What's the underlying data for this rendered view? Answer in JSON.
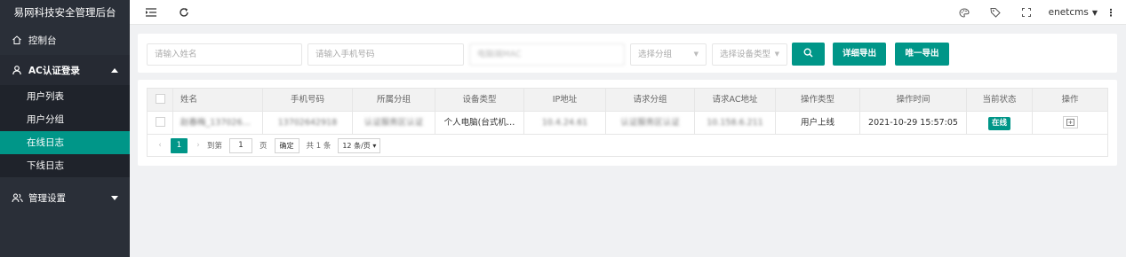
{
  "brand": "易网科技安全管理后台",
  "colors": {
    "accent": "#009688",
    "sidebar_bg": "#2a2f38",
    "submenu_bg": "#1f232b"
  },
  "sidebar": {
    "dashboard": {
      "label": "控制台",
      "icon": "home-icon"
    },
    "ac_login": {
      "label": "AC认证登录",
      "icon": "user-icon",
      "expanded": true
    },
    "sub_items": [
      {
        "label": "用户列表"
      },
      {
        "label": "用户分组"
      },
      {
        "label": "在线日志",
        "active": true
      },
      {
        "label": "下线日志"
      }
    ],
    "settings": {
      "label": "管理设置",
      "icon": "users-icon"
    }
  },
  "header": {
    "user": "enetcms",
    "icons": [
      "menu-collapse-icon",
      "refresh-icon",
      "theme-icon",
      "tag-icon",
      "fullscreen-icon",
      "more-icon"
    ]
  },
  "filters": {
    "name_placeholder": "请输入姓名",
    "phone_placeholder": "请输入手机号码",
    "third_input_value": "电脑端MAC",
    "group_placeholder": "选择分组",
    "device_placeholder": "选择设备类型",
    "detail_export": "详细导出",
    "unique_export": "唯一导出"
  },
  "table": {
    "headers": [
      "姓名",
      "手机号码",
      "所属分组",
      "设备类型",
      "IP地址",
      "请求分组",
      "请求AC地址",
      "操作类型",
      "操作时间",
      "当前状态",
      "操作"
    ],
    "rows": [
      {
        "name": "赵春梅_137026…",
        "phone": "13702642918",
        "group": "认证服务区认证",
        "device": "个人电脑(台式机…",
        "ip": "10.4.24.61",
        "req_group": "认证服务区认证",
        "ac_addr": "10.158.6.211",
        "op_type": "用户上线",
        "op_time": "2021-10-29 15:57:05",
        "status": "在线"
      }
    ]
  },
  "pager": {
    "current": "1",
    "goto_label": "到第",
    "page_input": "1",
    "page_unit": "页",
    "confirm": "确定",
    "total": "共 1 条",
    "page_size": "12 条/页"
  }
}
